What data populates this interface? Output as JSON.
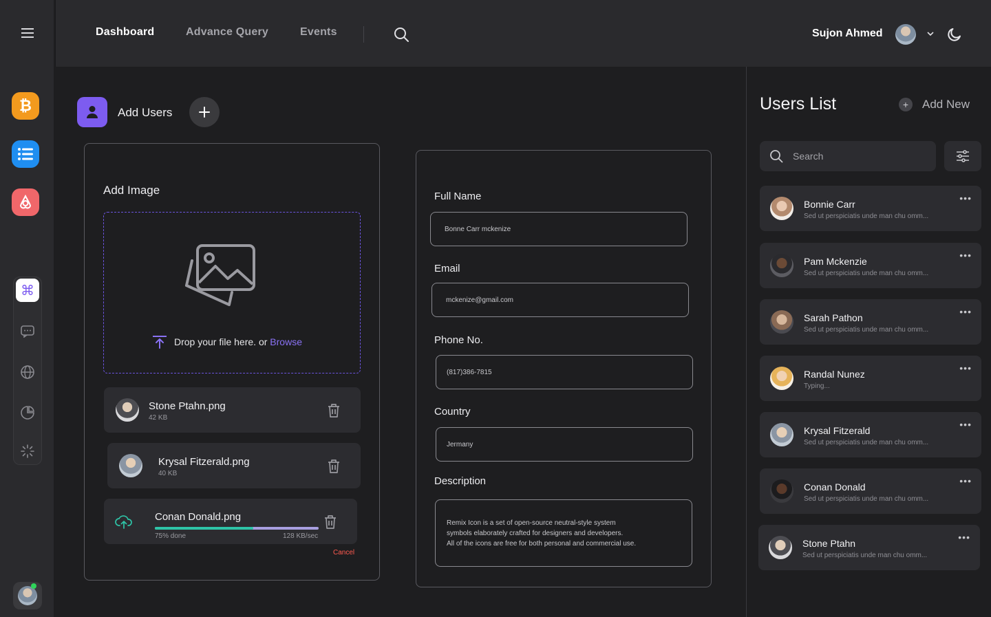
{
  "header": {
    "nav": [
      "Dashboard",
      "Advance Query",
      "Events"
    ],
    "user_name": "Sujon Ahmed"
  },
  "add_users": {
    "title": "Add Users"
  },
  "image_card": {
    "title": "Add Image",
    "drop_text": "Drop your file here. or",
    "browse_text": "Browse",
    "files": [
      {
        "name": "Stone Ptahn.png",
        "size": "42 KB"
      },
      {
        "name": "Krysal Fitzerald.png",
        "size": "40 KB"
      },
      {
        "name": "Conan Donald.png",
        "progress_label": "75% done",
        "speed": "128 KB/sec",
        "progress": 0.6
      }
    ],
    "cancel": "Cancel"
  },
  "form": {
    "full_name": {
      "label": "Full Name",
      "value": "Bonne Carr mckenize"
    },
    "email": {
      "label": "Email",
      "value": "mckenize@gmail.com"
    },
    "phone": {
      "label": "Phone No.",
      "value": "(817)386-7815"
    },
    "country": {
      "label": "Country",
      "value": "Jermany"
    },
    "description": {
      "label": "Description",
      "value": "Remix Icon is a set of open-source neutral-style system\nsymbols elaborately crafted for designers and developers.\nAll of the icons are free for both personal and commercial use."
    }
  },
  "users_panel": {
    "title": "Users List",
    "add_new": "Add New",
    "search_placeholder": "Search",
    "users": [
      {
        "name": "Bonnie Carr",
        "message": "Sed ut perspiciatis unde man chu omm..."
      },
      {
        "name": "Pam Mckenzie",
        "message": "Sed ut perspiciatis unde man chu omm..."
      },
      {
        "name": "Sarah Pathon",
        "message": "Sed ut perspiciatis unde man chu omm..."
      },
      {
        "name": "Randal Nunez",
        "message": "Typing..."
      },
      {
        "name": "Krysal Fitzerald",
        "message": "Sed ut perspiciatis unde man chu omm..."
      },
      {
        "name": "Conan Donald",
        "message": "Sed ut perspiciatis unde man chu omm..."
      },
      {
        "name": "Stone Ptahn",
        "message": "Sed ut perspiciatis unde man chu omm..."
      }
    ]
  },
  "colors": {
    "accent": "#7d5cf0",
    "progress": "#2ec4a7",
    "danger": "#ff5a4f"
  },
  "icons": [
    "menu-icon",
    "bitcoin-icon",
    "list-icon",
    "airbnb-icon",
    "command-icon",
    "chat-icon",
    "globe-icon",
    "pie-chart-icon",
    "loader-icon",
    "search-icon",
    "chevron-down-icon",
    "moon-icon",
    "user-icon",
    "plus-icon",
    "image-icon",
    "upload-icon",
    "trash-icon",
    "upload-cloud-icon",
    "filter-icon",
    "more-icon"
  ]
}
